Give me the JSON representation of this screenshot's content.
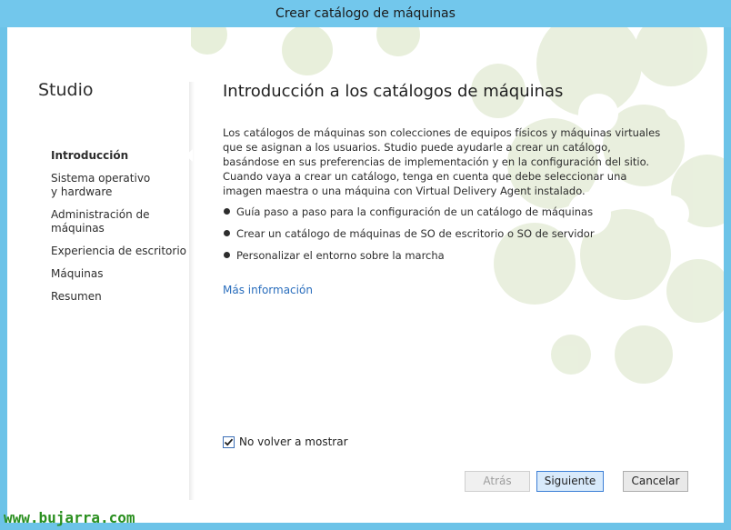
{
  "window": {
    "title": "Crear catálogo de máquinas"
  },
  "sidebar": {
    "app_name": "Studio",
    "items": [
      {
        "label": "Introducción",
        "active": true
      },
      {
        "label": "Sistema operativo y hardware",
        "active": false
      },
      {
        "label": "Administración de máquinas",
        "active": false
      },
      {
        "label": "Experiencia de escritorio",
        "active": false
      },
      {
        "label": "Máquinas",
        "active": false
      },
      {
        "label": "Resumen",
        "active": false
      }
    ]
  },
  "main": {
    "title": "Introducción a los catálogos de máquinas",
    "description": "Los catálogos de máquinas son colecciones de equipos físicos y máquinas virtuales que se asignan a los usuarios. Studio puede ayudarle a crear un catálogo, basándose en sus preferencias de implementación y en la configuración del sitio. Cuando vaya a crear un catálogo, tenga en cuenta que debe seleccionar una imagen maestra o una máquina con Virtual Delivery Agent instalado.",
    "bullets": [
      "Guía paso a paso para la configuración de un catálogo de máquinas",
      "Crear un catálogo de máquinas de SO de escritorio o SO de servidor",
      "Personalizar el entorno sobre la marcha"
    ],
    "more_info_link": "Más información"
  },
  "footer": {
    "dont_show_again_label": "No volver a mostrar",
    "dont_show_again_checked": true,
    "back_label": "Atrás",
    "next_label": "Siguiente",
    "cancel_label": "Cancelar"
  },
  "watermark": "www.bujarra.com",
  "colors": {
    "titlebar": "#72c7ec",
    "accent_green": "#c9dcae",
    "link": "#2a6ebd"
  }
}
